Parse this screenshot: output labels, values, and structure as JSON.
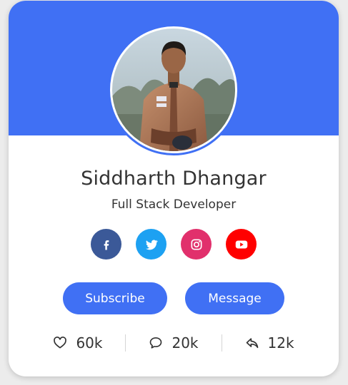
{
  "profile": {
    "name": "Siddharth Dhangar",
    "role": "Full Stack Developer"
  },
  "social": [
    {
      "icon": "facebook-icon",
      "color": "#3b5998"
    },
    {
      "icon": "twitter-icon",
      "color": "#1da1f2"
    },
    {
      "icon": "instagram-icon",
      "color": "#e1306c"
    },
    {
      "icon": "youtube-icon",
      "color": "#ff0000"
    }
  ],
  "actions": {
    "subscribe_label": "Subscribe",
    "message_label": "Message"
  },
  "stats": {
    "likes": "60k",
    "comments": "20k",
    "shares": "12k"
  },
  "theme": {
    "accent": "#4070f4"
  }
}
